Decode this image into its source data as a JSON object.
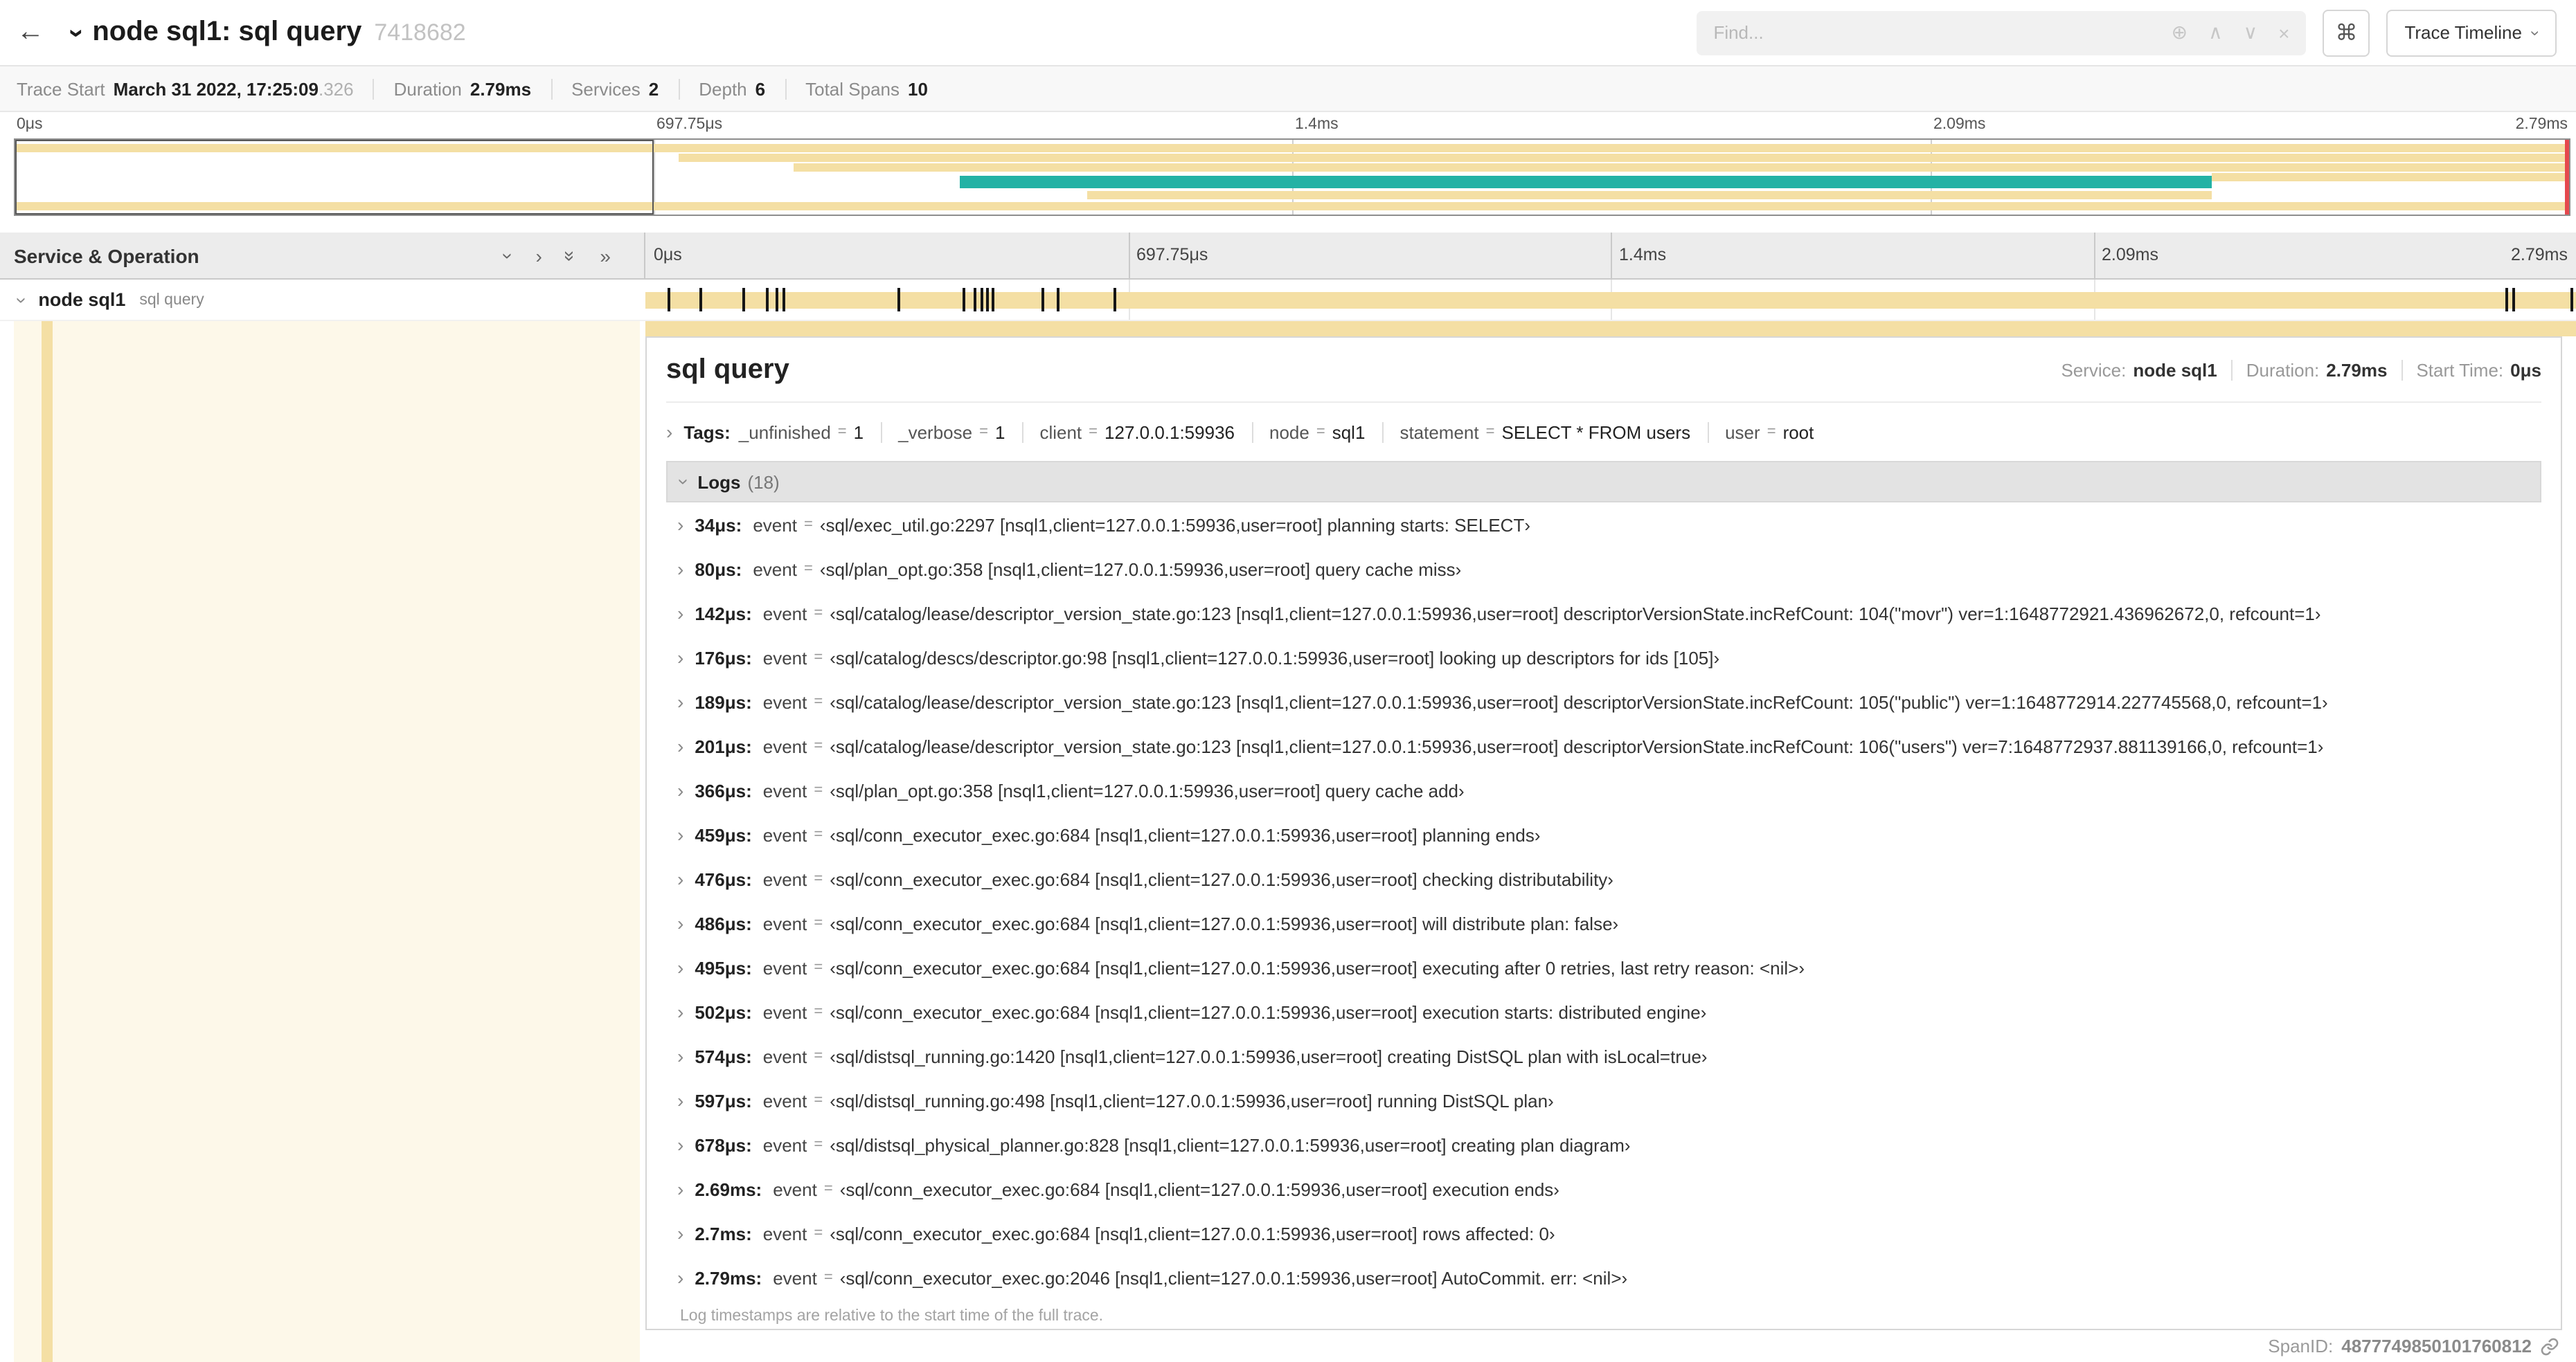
{
  "header": {
    "title": "node sql1: sql query",
    "trace_id": "7418682",
    "find_placeholder": "Find...",
    "trace_timeline_label": "Trace Timeline"
  },
  "icons": {
    "back": "←",
    "plus_circle": "⊕",
    "caret_up": "∧",
    "caret_down": "∨",
    "close": "×",
    "command": "⌘"
  },
  "summary": {
    "items": [
      {
        "label": "Trace Start",
        "value": "March 31 2022, 17:25:09",
        "suffix": ".326"
      },
      {
        "label": "Duration",
        "value": "2.79ms",
        "suffix": ""
      },
      {
        "label": "Services",
        "value": "2",
        "suffix": ""
      },
      {
        "label": "Depth",
        "value": "6",
        "suffix": ""
      },
      {
        "label": "Total Spans",
        "value": "10",
        "suffix": ""
      }
    ]
  },
  "colors": {
    "span_tan": "#f4dfa4",
    "span_teal": "#23b2a5",
    "marker_black": "#161616",
    "scrubber_red": "#e5484d"
  },
  "minimap": {
    "ticks": [
      "0μs",
      "697.75μs",
      "1.4ms",
      "2.09ms",
      "2.79ms"
    ],
    "bars": [
      {
        "t": 3,
        "l": 0,
        "w": 100,
        "h": 6,
        "c": "#f4dfa4"
      },
      {
        "t": 10,
        "l": 26,
        "w": 74,
        "h": 6,
        "c": "#f4dfa4"
      },
      {
        "t": 17,
        "l": 30.5,
        "w": 69.5,
        "h": 6,
        "c": "#f4dfa4"
      },
      {
        "t": 24,
        "l": 86,
        "w": 14,
        "h": 6,
        "c": "#f4dfa4"
      },
      {
        "t": 26,
        "l": 37,
        "w": 49,
        "h": 9,
        "c": "#23b2a5"
      },
      {
        "t": 37,
        "l": 42,
        "w": 44,
        "h": 6,
        "c": "#f4dfa4"
      },
      {
        "t": 45,
        "l": 0,
        "w": 100,
        "h": 6,
        "c": "#f4dfa4"
      }
    ]
  },
  "timeline": {
    "left_header": "Service & Operation",
    "ticks": [
      "0μs",
      "697.75μs",
      "1.4ms",
      "2.09ms",
      "2.79ms"
    ],
    "row": {
      "service": "node sql1",
      "operation": "sql query"
    },
    "markers": [
      1.2,
      2.9,
      5.1,
      6.3,
      6.8,
      7.2,
      13.1,
      16.5,
      17.1,
      17.4,
      17.7,
      18,
      20.6,
      21.4,
      24.3,
      96.4,
      96.8,
      99.8
    ]
  },
  "detail": {
    "title": "sql query",
    "meta": [
      {
        "label": "Service:",
        "value": "node sql1"
      },
      {
        "label": "Duration:",
        "value": "2.79ms"
      },
      {
        "label": "Start Time:",
        "value": "0μs"
      }
    ],
    "tags_label": "Tags:",
    "tags": [
      {
        "key": "_unfinished",
        "eq": "=",
        "value": "1"
      },
      {
        "key": "_verbose",
        "eq": "=",
        "value": "1"
      },
      {
        "key": "client",
        "eq": "=",
        "value": "127.0.0.1:59936"
      },
      {
        "key": "node",
        "eq": "=",
        "value": "sql1"
      },
      {
        "key": "statement",
        "eq": "=",
        "value": "SELECT * FROM users"
      },
      {
        "key": "user",
        "eq": "=",
        "value": "root"
      }
    ],
    "logs_label": "Logs",
    "logs_count": "(18)",
    "logs": [
      {
        "time": "34μs:",
        "key": "event",
        "eq": "=",
        "value": "‹sql/exec_util.go:2297 [nsql1,client=127.0.0.1:59936,user=root] planning starts: SELECT›"
      },
      {
        "time": "80μs:",
        "key": "event",
        "eq": "=",
        "value": "‹sql/plan_opt.go:358 [nsql1,client=127.0.0.1:59936,user=root] query cache miss›"
      },
      {
        "time": "142μs:",
        "key": "event",
        "eq": "=",
        "value": "‹sql/catalog/lease/descriptor_version_state.go:123 [nsql1,client=127.0.0.1:59936,user=root] descriptorVersionState.incRefCount: 104(\"movr\") ver=1:1648772921.436962672,0, refcount=1›"
      },
      {
        "time": "176μs:",
        "key": "event",
        "eq": "=",
        "value": "‹sql/catalog/descs/descriptor.go:98 [nsql1,client=127.0.0.1:59936,user=root] looking up descriptors for ids [105]›"
      },
      {
        "time": "189μs:",
        "key": "event",
        "eq": "=",
        "value": "‹sql/catalog/lease/descriptor_version_state.go:123 [nsql1,client=127.0.0.1:59936,user=root] descriptorVersionState.incRefCount: 105(\"public\") ver=1:1648772914.227745568,0, refcount=1›"
      },
      {
        "time": "201μs:",
        "key": "event",
        "eq": "=",
        "value": "‹sql/catalog/lease/descriptor_version_state.go:123 [nsql1,client=127.0.0.1:59936,user=root] descriptorVersionState.incRefCount: 106(\"users\") ver=7:1648772937.881139166,0, refcount=1›"
      },
      {
        "time": "366μs:",
        "key": "event",
        "eq": "=",
        "value": "‹sql/plan_opt.go:358 [nsql1,client=127.0.0.1:59936,user=root] query cache add›"
      },
      {
        "time": "459μs:",
        "key": "event",
        "eq": "=",
        "value": "‹sql/conn_executor_exec.go:684 [nsql1,client=127.0.0.1:59936,user=root] planning ends›"
      },
      {
        "time": "476μs:",
        "key": "event",
        "eq": "=",
        "value": "‹sql/conn_executor_exec.go:684 [nsql1,client=127.0.0.1:59936,user=root] checking distributability›"
      },
      {
        "time": "486μs:",
        "key": "event",
        "eq": "=",
        "value": "‹sql/conn_executor_exec.go:684 [nsql1,client=127.0.0.1:59936,user=root] will distribute plan: false›"
      },
      {
        "time": "495μs:",
        "key": "event",
        "eq": "=",
        "value": "‹sql/conn_executor_exec.go:684 [nsql1,client=127.0.0.1:59936,user=root] executing after 0 retries, last retry reason: <nil>›"
      },
      {
        "time": "502μs:",
        "key": "event",
        "eq": "=",
        "value": "‹sql/conn_executor_exec.go:684 [nsql1,client=127.0.0.1:59936,user=root] execution starts: distributed engine›"
      },
      {
        "time": "574μs:",
        "key": "event",
        "eq": "=",
        "value": "‹sql/distsql_running.go:1420 [nsql1,client=127.0.0.1:59936,user=root] creating DistSQL plan with isLocal=true›"
      },
      {
        "time": "597μs:",
        "key": "event",
        "eq": "=",
        "value": "‹sql/distsql_running.go:498 [nsql1,client=127.0.0.1:59936,user=root] running DistSQL plan›"
      },
      {
        "time": "678μs:",
        "key": "event",
        "eq": "=",
        "value": "‹sql/distsql_physical_planner.go:828 [nsql1,client=127.0.0.1:59936,user=root] creating plan diagram›"
      },
      {
        "time": "2.69ms:",
        "key": "event",
        "eq": "=",
        "value": "‹sql/conn_executor_exec.go:684 [nsql1,client=127.0.0.1:59936,user=root] execution ends›"
      },
      {
        "time": "2.7ms:",
        "key": "event",
        "eq": "=",
        "value": "‹sql/conn_executor_exec.go:684 [nsql1,client=127.0.0.1:59936,user=root] rows affected: 0›"
      },
      {
        "time": "2.79ms:",
        "key": "event",
        "eq": "=",
        "value": "‹sql/conn_executor_exec.go:2046 [nsql1,client=127.0.0.1:59936,user=root] AutoCommit. err: <nil>›"
      }
    ],
    "footer_note": "Log timestamps are relative to the start time of the full trace.",
    "span_id_label": "SpanID:",
    "span_id": "4877749850101760812"
  }
}
